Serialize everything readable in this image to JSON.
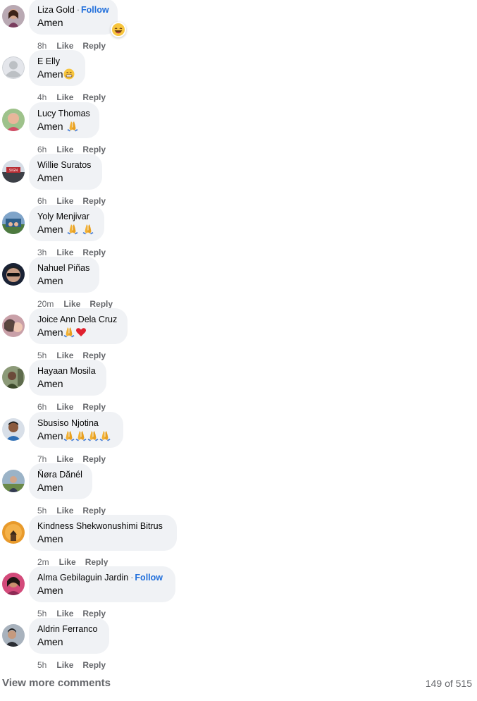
{
  "comments": [
    {
      "name": "Liza Gold",
      "follow": "Follow",
      "text": "Amen",
      "time": "8h",
      "like": "Like",
      "reply": "Reply",
      "emoji": "grin-emoji",
      "reaction": "laughing-emoji"
    },
    {
      "name": "E Elly",
      "follow": "",
      "text": "Amen",
      "time": "4h",
      "like": "Like",
      "reply": "Reply",
      "emoji": "grimace-emoji"
    },
    {
      "name": "Lucy Thomas",
      "follow": "",
      "text": "Amen ",
      "time": "6h",
      "like": "Like",
      "reply": "Reply",
      "emoji": "praying-hands-emoji"
    },
    {
      "name": "Willie Suratos",
      "follow": "",
      "text": "Amen",
      "time": "6h",
      "like": "Like",
      "reply": "Reply"
    },
    {
      "name": "Yoly Menjivar",
      "follow": "",
      "text": "Amen ",
      "time": "3h",
      "like": "Like",
      "reply": "Reply",
      "emoji": "praying-hands-emoji x2"
    },
    {
      "name": "Nahuel Piñas",
      "follow": "",
      "text": "Amen",
      "time": "20m",
      "like": "Like",
      "reply": "Reply"
    },
    {
      "name": "Joice Ann Dela Cruz",
      "follow": "",
      "text": "Amen",
      "time": "5h",
      "like": "Like",
      "reply": "Reply",
      "emoji": "praying-hands-emoji + red-heart-emoji"
    },
    {
      "name": "Hayaan Mosila",
      "follow": "",
      "text": "Amen",
      "time": "6h",
      "like": "Like",
      "reply": "Reply"
    },
    {
      "name": "Sbusiso Njotina",
      "follow": "",
      "text": "Amen",
      "time": "7h",
      "like": "Like",
      "reply": "Reply",
      "emoji": "praying-hands-emoji x4"
    },
    {
      "name": "Ňøra Dănél",
      "follow": "",
      "text": "Amen",
      "time": "5h",
      "like": "Like",
      "reply": "Reply"
    },
    {
      "name": "Kindness Shekwonushimi Bitrus",
      "follow": "",
      "text": "Amen",
      "time": "2m",
      "like": "Like",
      "reply": "Reply"
    },
    {
      "name": "Alma Gebilaguin Jardin",
      "follow": "Follow",
      "text": "Amen",
      "time": "5h",
      "like": "Like",
      "reply": "Reply"
    },
    {
      "name": "Aldrin Ferranco",
      "follow": "",
      "text": "Amen",
      "time": "5h",
      "like": "Like",
      "reply": "Reply"
    }
  ],
  "footer": {
    "view_more": "View more comments",
    "count": "149 of 515"
  },
  "colors": {
    "bubble": "#f0f2f5",
    "link": "#216fdb",
    "meta": "#65676b",
    "text": "#050505"
  }
}
